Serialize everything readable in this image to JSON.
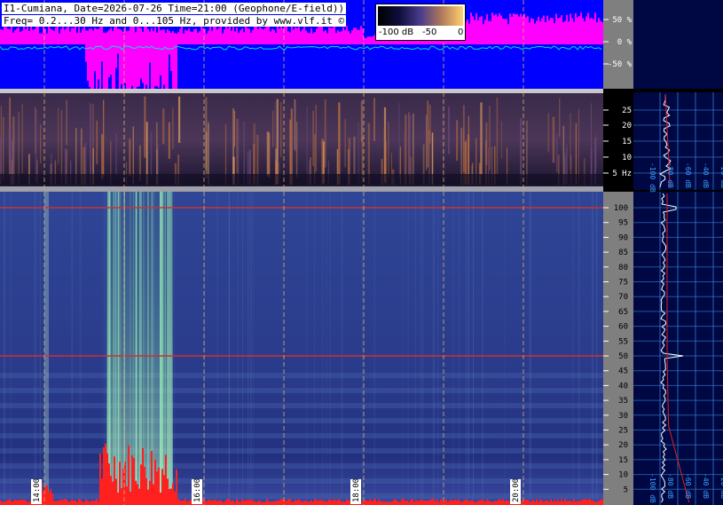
{
  "header": {
    "line1": "I1-Cumiana, Date=2026-07-26 Time=21:00 (Geophone/E-field))",
    "line2": "Freq= 0.2...30 Hz and 0...105 Hz, provided by www.vlf.it ©"
  },
  "colorbar": {
    "label_min": "-100 dB",
    "label_mid": "-50",
    "label_max": "0",
    "colors": [
      "#000000",
      "#0d0d3a",
      "#4a3c8c",
      "#b07a5a",
      "#ffd070"
    ]
  },
  "top_panel": {
    "axis_label": "%",
    "ticks": [
      "50 %",
      "0 %",
      "-50 %"
    ],
    "colors": {
      "background": "#0000ff",
      "fill": "#ff00ff",
      "trace": "#00e0e0"
    }
  },
  "mid_panel": {
    "ticks": [
      "25",
      "20",
      "15",
      "10",
      "5 Hz"
    ],
    "side_labels": [
      "-100 dB",
      "-80 dB",
      "-60 dB",
      "-40 dB",
      "-20 dB"
    ]
  },
  "low_panel": {
    "ticks": [
      "100",
      "95",
      "90",
      "85",
      "80",
      "75",
      "70",
      "65",
      "60",
      "55",
      "50",
      "45",
      "40",
      "35",
      "30",
      "25",
      "20",
      "15",
      "10",
      "5"
    ],
    "side_labels": [
      "-100 dB",
      "-80 dB",
      "-60 dB",
      "-40 dB",
      "-20 dB"
    ]
  },
  "time_labels": [
    "14:00",
    "16:00",
    "18:00",
    "20:00"
  ],
  "colors": {
    "spectro_base": "#2b3a86",
    "mains_line": "#d03030",
    "grid_dash": "#d8b070",
    "side_bg": "#000844",
    "side_grid": "#3aa0ff"
  }
}
